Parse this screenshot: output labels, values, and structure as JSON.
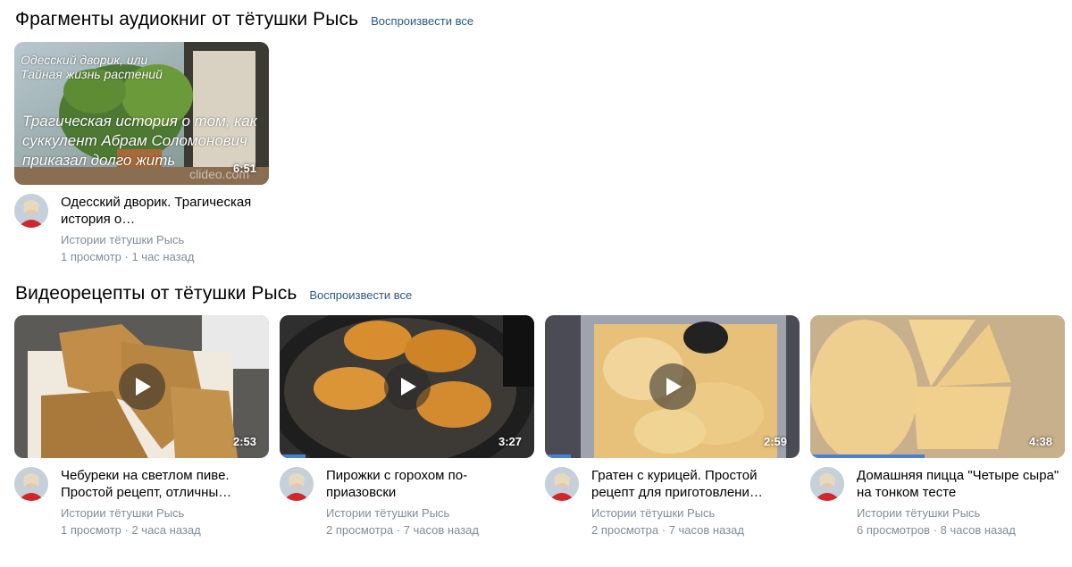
{
  "sections": [
    {
      "title": "Фрагменты аудиокниг от тётушки Рысь",
      "play_all": "Воспроизвести все",
      "videos": [
        {
          "title": "Одесский дворик. Трагическая история о…",
          "channel": "Истории тётушки Рысь",
          "stats": "1 просмотр · 1 час назад",
          "duration": "6:51",
          "thumb_lines": [
            "Одесский дворик, или",
            "Тайная жизнь растений"
          ],
          "thumb_caption": [
            "Трагическая история о том, как",
            "суккулент Абрам Соломонович",
            "приказал долго жить"
          ],
          "watermark": "clideo.com"
        }
      ]
    },
    {
      "title": "Видеорецепты от тётушки Рысь",
      "play_all": "Воспроизвести все",
      "videos": [
        {
          "title": "Чебуреки на светлом пиве. Простой рецепт, отличны…",
          "channel": "Истории тётушки Рысь",
          "stats": "1 просмотр · 2 часа назад",
          "duration": "2:53",
          "progress": 0
        },
        {
          "title": "Пирожки с горохом по-приазовски",
          "channel": "Истории тётушки Рысь",
          "stats": "2 просмотра · 7 часов назад",
          "duration": "3:27",
          "progress": 0.1
        },
        {
          "title": "Гратен с курицей. Простой рецепт для приготовлени…",
          "channel": "Истории тётушки Рысь",
          "stats": "2 просмотра · 7 часов назад",
          "duration": "2:59",
          "progress": 0.1
        },
        {
          "title": "Домашняя пицца \"Четыре сыра\" на тонком тесте",
          "channel": "Истории тётушки Рысь",
          "stats": "6 просмотров · 8 часов назад",
          "duration": "4:38",
          "progress": 0.45
        }
      ]
    }
  ],
  "colors": {
    "link": "#2a5885",
    "muted": "#818c99",
    "progress": "#4a7fd6"
  }
}
